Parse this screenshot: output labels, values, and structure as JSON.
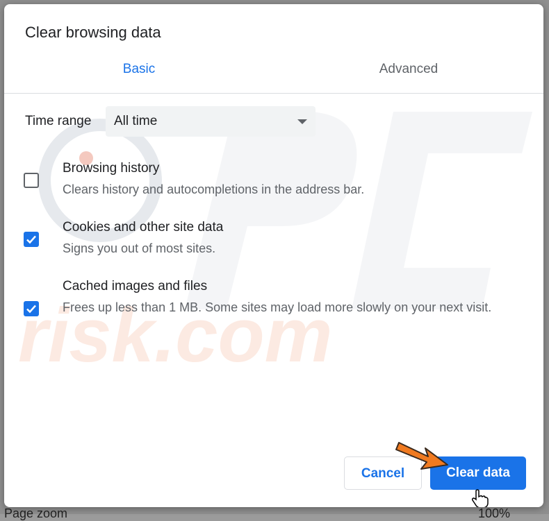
{
  "background": {
    "left_text": "Page zoom",
    "right_text": "100%"
  },
  "dialog": {
    "title": "Clear browsing data",
    "tabs": [
      {
        "label": "Basic",
        "active": true
      },
      {
        "label": "Advanced",
        "active": false
      }
    ],
    "time_range": {
      "label": "Time range",
      "selected": "All time"
    },
    "items": [
      {
        "title": "Browsing history",
        "description": "Clears history and autocompletions in the address bar.",
        "checked": false
      },
      {
        "title": "Cookies and other site data",
        "description": "Signs you out of most sites.",
        "checked": true
      },
      {
        "title": "Cached images and files",
        "description": "Frees up less than 1 MB. Some sites may load more slowly on your next visit.",
        "checked": true
      }
    ],
    "buttons": {
      "cancel": "Cancel",
      "clear": "Clear data"
    }
  },
  "colors": {
    "accent": "#1a73e8",
    "annotation_arrow": "#f07a20"
  },
  "icons": {
    "dropdown": "chevron-down-icon",
    "checkbox_checked": "check-icon",
    "cursor": "hand-pointer-icon",
    "annotation": "arrow-icon"
  }
}
